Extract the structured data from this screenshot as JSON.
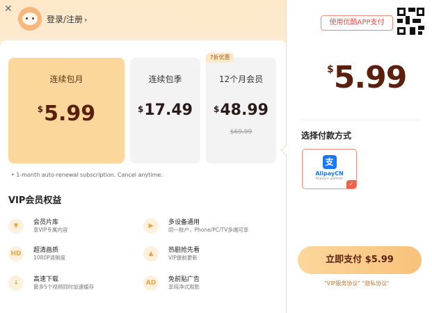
{
  "header": {
    "close_icon": "close-icon",
    "login_label": "登录/注册",
    "login_chevron": "›"
  },
  "plans": [
    {
      "name": "连续包月",
      "currency": "$",
      "price": "5.99",
      "selected": true
    },
    {
      "name": "连续包季",
      "currency": "$",
      "price": "17.49"
    },
    {
      "name": "12个月会员",
      "currency": "$",
      "price": "48.99",
      "original_price": "$69.99",
      "badge": "7折优惠"
    }
  ],
  "note": "• 1-month auto-renewal subscription. Cancel anytime.",
  "benefits": {
    "title": "VIP会员权益",
    "items": [
      {
        "title": "会员片库",
        "desc": "享VIP专属内容",
        "icon": "library-icon"
      },
      {
        "title": "多设备通用",
        "desc": "同一账户，Phone/PC/TV多端可享",
        "icon": "devices-icon"
      },
      {
        "title": "超清画质",
        "desc": "1080P清晰度",
        "icon": "hd-icon"
      },
      {
        "title": "热剧抢先看",
        "desc": "VIP提前更新",
        "icon": "early-access-icon"
      },
      {
        "title": "高速下载",
        "desc": "最多5个视频同时加速缓存",
        "icon": "download-icon"
      },
      {
        "title": "免前贴广告",
        "desc": "享纯净式观影",
        "icon": "ad-free-icon"
      }
    ]
  },
  "right": {
    "app_pay_label": "使用优酷APP支付",
    "currency": "$",
    "price": "5.99",
    "pay_method_title": "选择付款方式",
    "alipay": {
      "name": "AlipayCN",
      "sub": "Alipay+ partner",
      "glyph": "支"
    },
    "pay_button": "立即支付 $5.99",
    "agreement": "\"VIP服务协议\" \"隐私协议\""
  },
  "colors": {
    "accent": "#fcd79c",
    "price": "#5a1f0d",
    "alipay_blue": "#1677ff",
    "red": "#e8504a"
  }
}
